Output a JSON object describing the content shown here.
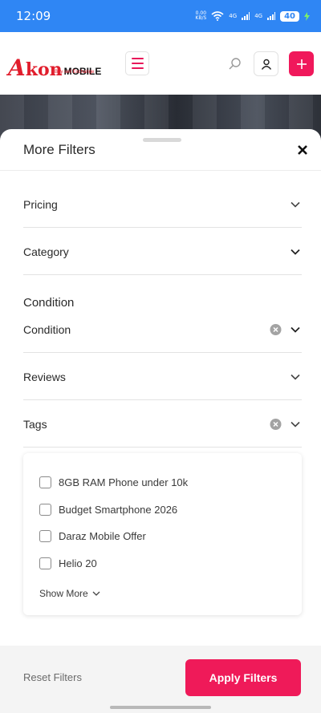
{
  "status_bar": {
    "time": "12:09",
    "net_speed_value": "0.00",
    "net_speed_unit": "KB/S",
    "signal1": "4G",
    "signal2": "4G",
    "battery": "40"
  },
  "header": {
    "logo_a": "A",
    "logo_kon": "kon",
    "logo_mobile": "MOBILE",
    "logo_tagline": "Buy sell Exchange"
  },
  "sheet": {
    "title": "More Filters",
    "rows": {
      "pricing": "Pricing",
      "category": "Category",
      "condition": "Condition",
      "reviews": "Reviews",
      "tags": "Tags"
    },
    "condition_heading": "Condition",
    "tags_options": [
      "8GB RAM Phone under 10k",
      "Budget Smartphone 2026",
      "Daraz Mobile Offer",
      "Helio 20"
    ],
    "show_more": "Show More"
  },
  "footer": {
    "reset": "Reset Filters",
    "apply": "Apply Filters"
  },
  "colors": {
    "status_bar": "#2f86f4",
    "brand_pink": "#ef1a59",
    "logo_red": "#e11d2c"
  }
}
